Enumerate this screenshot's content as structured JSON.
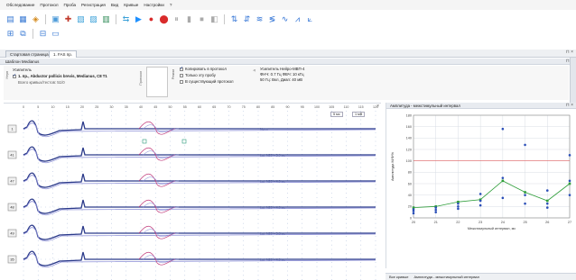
{
  "menu": [
    "Обследование",
    "Протокол",
    "Проба",
    "Регистрация",
    "Вид",
    "Кривые",
    "Настройки",
    "?"
  ],
  "toolbar_icons": {
    "row1": [
      "open-file-icon",
      "save-icon",
      "export-icon",
      "print-icon",
      "patient-icon",
      "settings-icon",
      "filter-icon",
      "stats-icon",
      "play-icon",
      "stop-icon",
      "record-icon",
      "pause-icon",
      "step-icon",
      "monitor-icon",
      "stimulus-icon",
      "marker-icon",
      "measure-icon",
      "wave-icon",
      "averaging-icon",
      "latency-icon",
      "amplitude-icon",
      "compare-icon",
      "tool-icon"
    ],
    "row2": [
      "layout-icon",
      "copy-icon",
      "channels-icon",
      "view-icon"
    ]
  },
  "tabs": [
    {
      "label": "Стартовая страница",
      "active": false
    },
    {
      "label": "1. FAS пр.",
      "active": true
    }
  ],
  "template_panel": {
    "header": "Шаблон Medianus",
    "side_label_1": "Нерв",
    "side_label_2": "Протокол",
    "side_label_3": "Режим",
    "nerve_title": "Усилитель",
    "muscle": "1. пр., Abductor pollicis brevis, Medianus, C8 T1",
    "total_curves": "Всего кривых/тестов: 51/0",
    "copy_to_protocol": "Копировать в протокол",
    "only_this_probe": "Только эту пробу",
    "existing_protocol": "В существующий протокол",
    "amp_title": "Усилитель Нейро-МВП-4",
    "amp_line1": "ФНЧ: 0.7 Гц ФВЧ: 10 кГц",
    "amp_line2": "50 Гц: Вкл, Диап: 40 мВ"
  },
  "main_panel": {
    "sweep_selector": "5 мс",
    "gain_selector": "1 мВ",
    "channels": [
      "1",
      "41",
      "47",
      "48",
      "49",
      "35"
    ],
    "latency_labels": [
      "Norm",
      "Lat: N20 = 3.9 мс",
      "Lat: N20 = 4.0 мс",
      "Lat: N20 = 4.0 мс",
      "Lat: N20 = 3.8 мс",
      "Lat: N20 = 4.0 мс"
    ],
    "top_ruler": [
      "0",
      "5",
      "10",
      "15",
      "20",
      "25",
      "30",
      "35",
      "40",
      "45",
      "50",
      "55",
      "60",
      "65",
      "70",
      "75",
      "80",
      "85",
      "90",
      "95",
      "100",
      "105",
      "110",
      "115",
      "120"
    ]
  },
  "chart_panel": {
    "header": "Амплитуда - межстимульный интервал",
    "ylabel": "Амплитуда M/Ф/%",
    "xlabel": "Межстимульный интервал, мс"
  },
  "chart_data": {
    "type": "scatter",
    "x": [
      20,
      21,
      22,
      23,
      24,
      25,
      26,
      27
    ],
    "xlim": [
      20,
      27
    ],
    "ylim": [
      0,
      180
    ],
    "yticks": [
      0,
      20,
      40,
      60,
      80,
      100,
      120,
      140,
      160,
      180
    ],
    "reference_line": 100,
    "series": [
      {
        "values": [
          18,
          20,
          28,
          32,
          65,
          45,
          30,
          60
        ],
        "style": "line",
        "color": "#2f9e3a"
      },
      {
        "values": [
          15,
          18,
          25,
          30,
          70,
          40,
          25,
          65
        ],
        "style": "points",
        "color": "#2b4fb8"
      },
      {
        "values": [
          12,
          14,
          20,
          42,
          156,
          128,
          48,
          110
        ],
        "style": "points",
        "color": "#2b4fb8"
      },
      {
        "values": [
          8,
          10,
          16,
          22,
          35,
          25,
          18,
          40
        ],
        "style": "points",
        "color": "#2b4fb8"
      }
    ],
    "grid": true,
    "ref_color": "#e06060"
  },
  "bottom_tabs": [
    "Все кривые",
    "Амплитуда - межстимульный интервал"
  ],
  "colors": {
    "trace_primary": "#2b3a8a",
    "trace_secondary": "#c0397a",
    "trace_light": "#8c8fd6",
    "grid": "#9fb3d6"
  }
}
